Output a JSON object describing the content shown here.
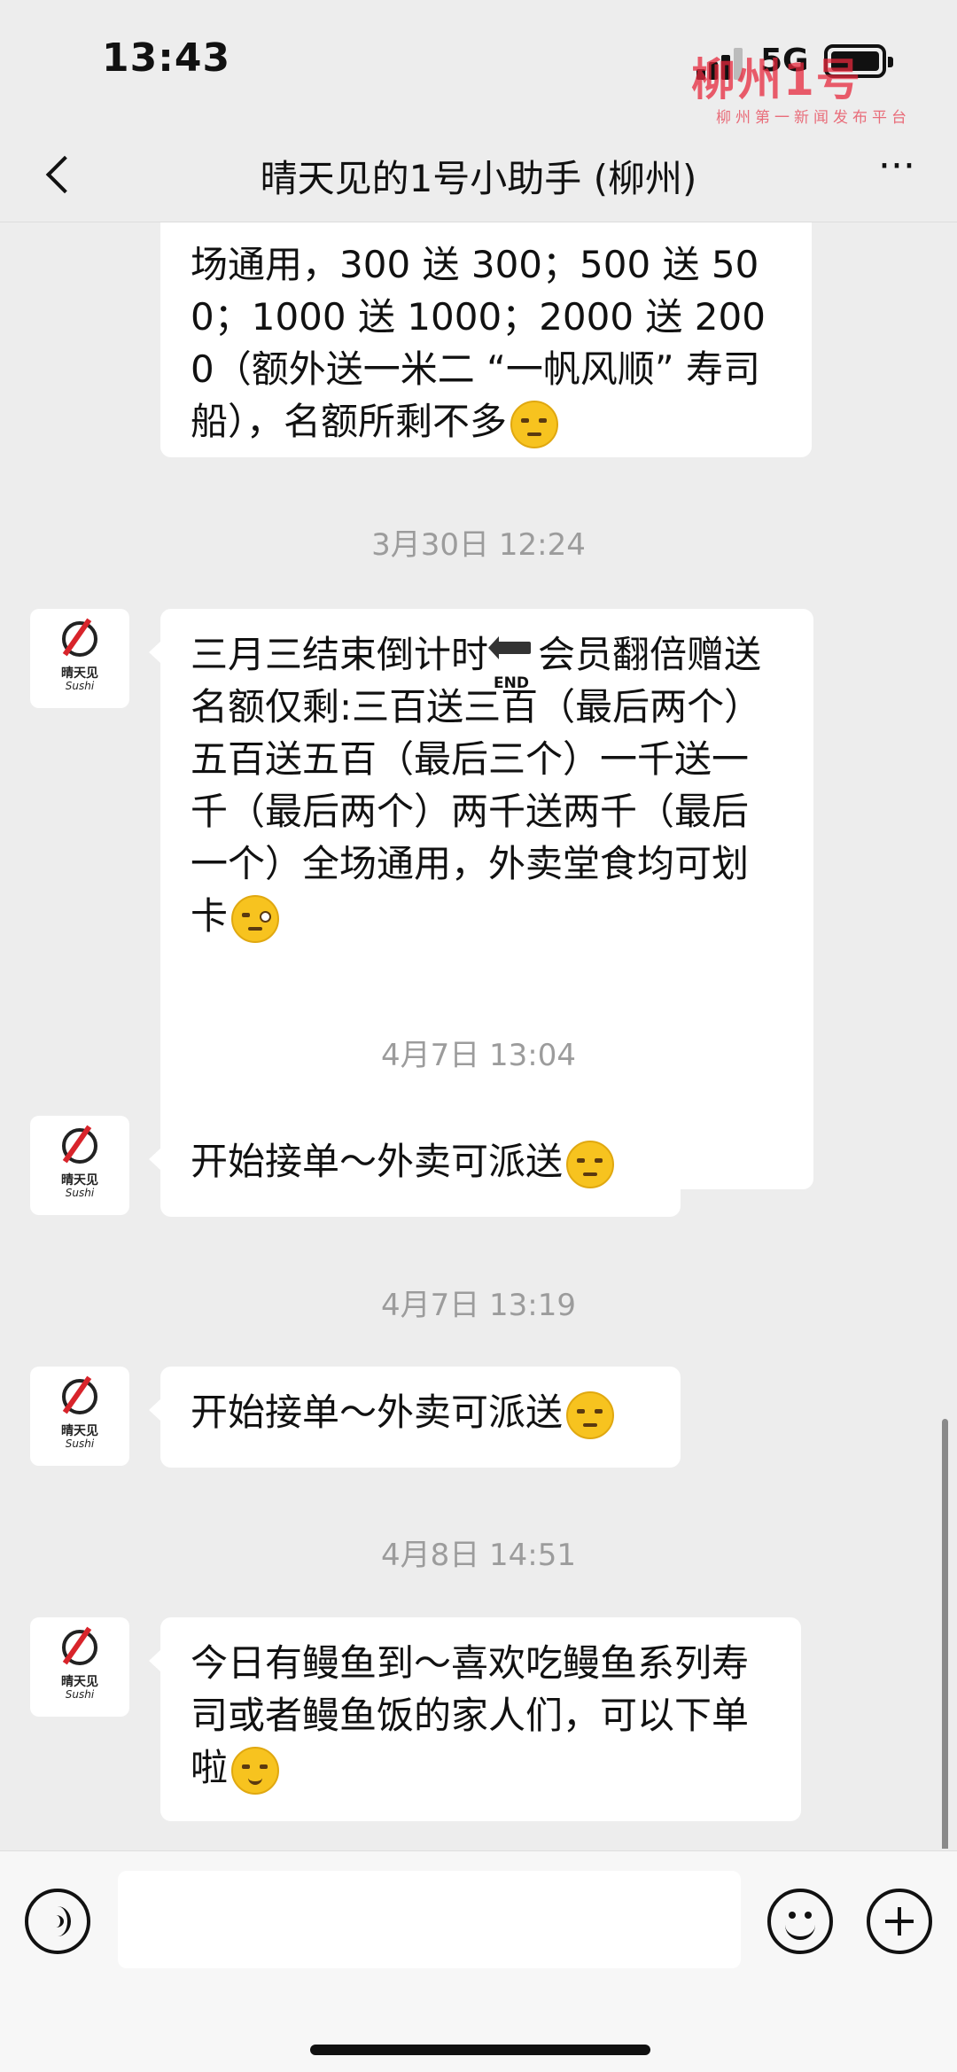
{
  "status_bar": {
    "time": "13:43",
    "network": "5G"
  },
  "header": {
    "title": "晴天见的1号小助手 (柳州)",
    "more_label": "···"
  },
  "watermark": {
    "logo": "柳州1号",
    "subtitle": "柳州第一新闻发布平台"
  },
  "avatar": {
    "name_cn": "晴天见",
    "name_en": "Sushi"
  },
  "messages": [
    {
      "text": "场通用，300 送 300；500 送 500；1000 送 1000；2000 送 2000（额外送一米二 “一帆风顺” 寿司船），名额所剩不多",
      "emoji": "smirk"
    },
    {
      "timestamp": "3月30日 12:24",
      "text_before": "三月三结束倒计时",
      "end_icon_label": "END",
      "text_after": "会员翻倍赠送名额仅剩:三百送三百（最后两个）五百送五百（最后三个）一千送一千（最后两个）两千送两千（最后一个）全场通用，外卖堂食均可划卡",
      "emoji": "wink"
    },
    {
      "timestamp": "4月7日 13:04",
      "text": "开始接单～外卖可派送",
      "emoji": "smirk"
    },
    {
      "timestamp": "4月7日 13:19",
      "text": "开始接单～外卖可派送",
      "emoji": "smirk"
    },
    {
      "timestamp": "4月8日 14:51",
      "text": "今日有鳗鱼到～喜欢吃鳗鱼系列寿司或者鳗鱼饭的家人们，可以下单啦",
      "emoji": "smile"
    }
  ]
}
